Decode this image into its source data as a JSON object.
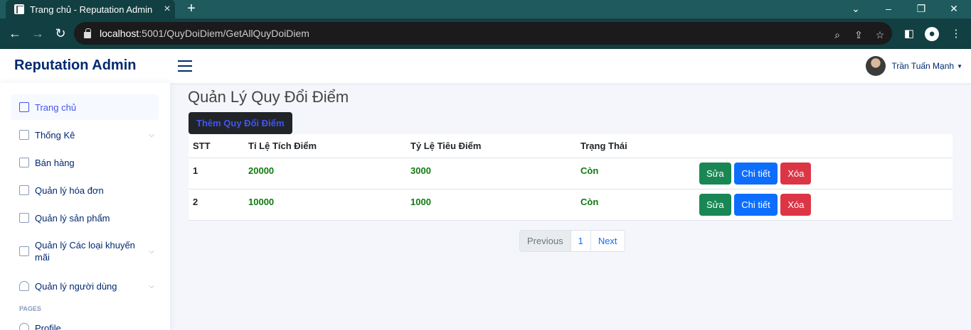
{
  "browser": {
    "tab_title": "Trang chủ - Reputation Admin",
    "url_host": "localhost",
    "url_path": ":5001/QuyDoiDiem/GetAllQuyDoiDiem"
  },
  "header": {
    "brand": "Reputation Admin",
    "user_name": "Trần Tuấn Mạnh"
  },
  "sidebar": {
    "items": [
      {
        "label": "Trang chủ"
      },
      {
        "label": "Thống Kê"
      },
      {
        "label": "Bán hàng"
      },
      {
        "label": "Quản lý hóa đơn"
      },
      {
        "label": "Quản lý sản phẩm"
      },
      {
        "label": "Quản lý Các loại khuyến mãi"
      },
      {
        "label": "Quản lý người dùng"
      },
      {
        "label": "Profile"
      }
    ],
    "section_heading": "PAGES"
  },
  "main": {
    "title": "Quản Lý Quy Đổi Điểm",
    "add_button": "Thêm Quy Đổi Điểm",
    "table": {
      "headers": [
        "STT",
        "Tỉ Lệ Tích Điểm",
        "Tỷ Lệ Tiêu Điểm",
        "Trạng Thái"
      ],
      "rows": [
        {
          "stt": "1",
          "tich": "20000",
          "tieu": "3000",
          "status": "Còn"
        },
        {
          "stt": "2",
          "tich": "10000",
          "tieu": "1000",
          "status": "Còn"
        }
      ],
      "actions": {
        "edit": "Sửa",
        "detail": "Chi tiết",
        "delete": "Xóa"
      }
    },
    "pagination": {
      "previous": "Previous",
      "page": "1",
      "next": "Next"
    }
  }
}
